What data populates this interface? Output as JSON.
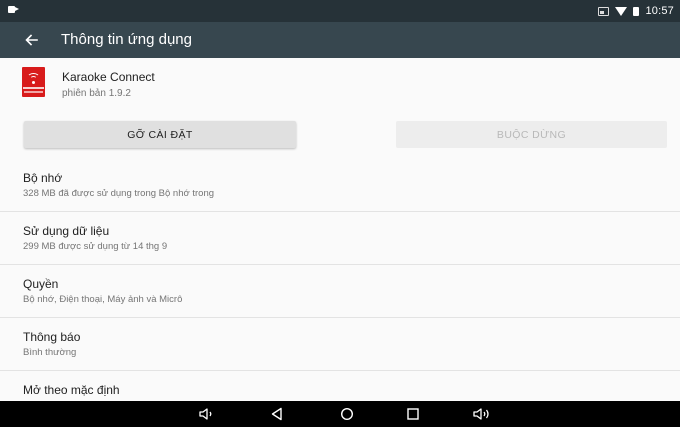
{
  "status_bar": {
    "time": "10:57",
    "icons": [
      "camera-icon",
      "cast-icon",
      "wifi-icon",
      "battery-icon"
    ]
  },
  "app_bar": {
    "title": "Thông tin ứng dụng",
    "back_icon": "arrow-back-icon"
  },
  "app": {
    "name": "Karaoke Connect",
    "version": "phiên bản 1.9.2",
    "icon": "karaoke-connect-app-icon"
  },
  "buttons": {
    "uninstall": "GỠ CÀI ĐẶT",
    "force_stop": "BUỘC DỪNG"
  },
  "settings": [
    {
      "title": "Bộ nhớ",
      "summary": "328 MB đã được sử dụng trong Bộ nhớ trong"
    },
    {
      "title": "Sử dụng dữ liệu",
      "summary": "299 MB được sử dụng từ 14 thg 9"
    },
    {
      "title": "Quyền",
      "summary": "Bộ nhớ, Điện thoại, Máy ảnh và Micrô"
    },
    {
      "title": "Thông báo",
      "summary": "Bình thường"
    },
    {
      "title": "Mở theo mặc định",
      "summary": ""
    }
  ],
  "nav_bar": {
    "buttons": [
      "volume-down-icon",
      "back-triangle-icon",
      "home-circle-icon",
      "recents-square-icon",
      "volume-up-icon"
    ]
  },
  "colors": {
    "status_bar": "#263238",
    "app_bar": "#37474f",
    "background": "#fafafa",
    "app_icon": "#d81b1b",
    "nav_bar": "#000000"
  }
}
